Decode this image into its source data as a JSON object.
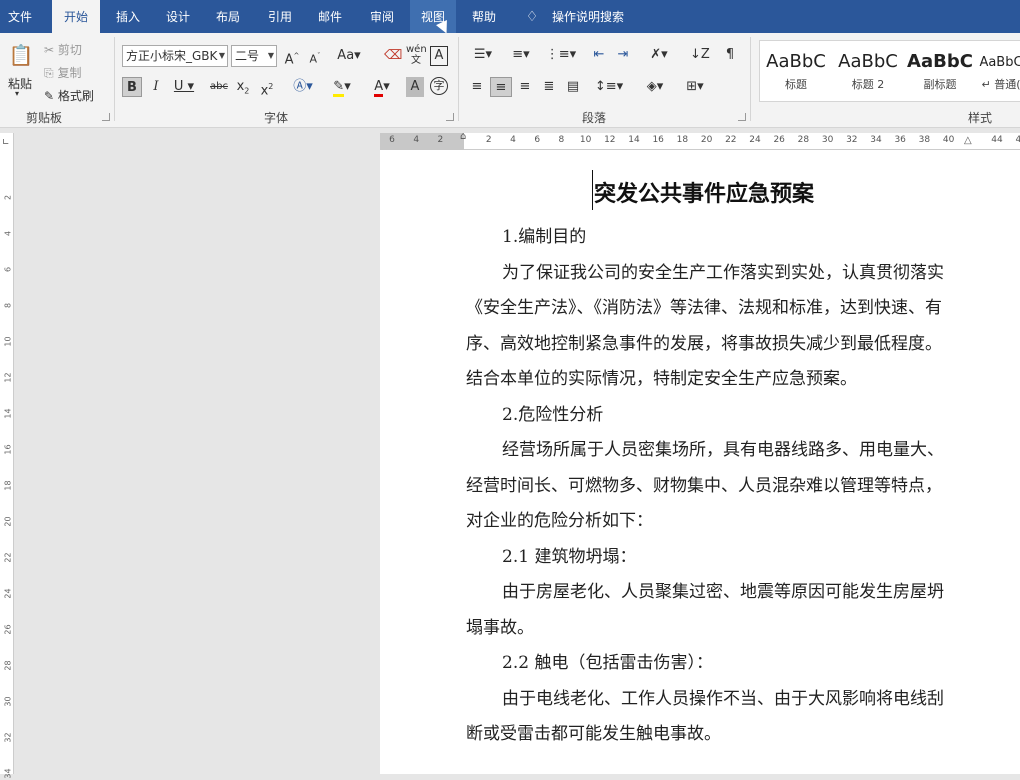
{
  "menubar": {
    "tabs": [
      "文件",
      "开始",
      "插入",
      "设计",
      "布局",
      "引用",
      "邮件",
      "审阅",
      "视图",
      "帮助"
    ],
    "search_label": "操作说明搜索",
    "bg_color": "#2b579a"
  },
  "clipboard": {
    "paste": "粘贴",
    "cut": "剪切",
    "copy": "复制",
    "format_painter": "格式刷",
    "group_label": "剪贴板"
  },
  "font": {
    "family": "方正小标宋_GBK",
    "size": "二号",
    "group_label": "字体"
  },
  "paragraph": {
    "group_label": "段落"
  },
  "styles": {
    "items": [
      {
        "preview": "AaBbC",
        "name": "标题"
      },
      {
        "preview": "AaBbC",
        "name": "标题 2"
      },
      {
        "preview": "AaBbC",
        "name": "副标题"
      },
      {
        "preview": "AaBbC",
        "name": "↵ 普通("
      }
    ],
    "group_label": "样式"
  },
  "ruler": {
    "ticks": [
      "6",
      "4",
      "2",
      "",
      "2",
      "4",
      "6",
      "8",
      "10",
      "12",
      "14",
      "16",
      "18",
      "20",
      "22",
      "24",
      "26",
      "28",
      "30",
      "32",
      "34",
      "36",
      "38",
      "40",
      "",
      "44",
      "46"
    ],
    "vticks": [
      "2",
      "4",
      "6",
      "8",
      "10",
      "12",
      "14",
      "16",
      "18",
      "20",
      "22",
      "24",
      "26",
      "28",
      "30",
      "32",
      "34"
    ]
  },
  "document": {
    "title": "突发公共事件应急预案",
    "lines": [
      "1.编制目的",
      "为了保证我公司的安全生产工作落实到实处，认真贯彻落实",
      "《安全生产法》、《消防法》等法律、法规和标准，达到快速、有",
      "序、高效地控制紧急事件的发展，将事故损失减少到最低程度。",
      "结合本单位的实际情况，特制定安全生产应急预案。",
      "2.危险性分析",
      "经营场所属于人员密集场所，具有电器线路多、用电量大、",
      "经营时间长、可燃物多、财物集中、人员混杂难以管理等特点，",
      "对企业的危险分析如下：",
      "2.1 建筑物坍塌：",
      "由于房屋老化、人员聚集过密、地震等原因可能发生房屋坍",
      "塌事故。",
      "2.2 触电（包括雷击伤害）：",
      "由于电线老化、工作人员操作不当、由于大风影响将电线刮",
      "断或受雷击都可能发生触电事故。"
    ]
  }
}
